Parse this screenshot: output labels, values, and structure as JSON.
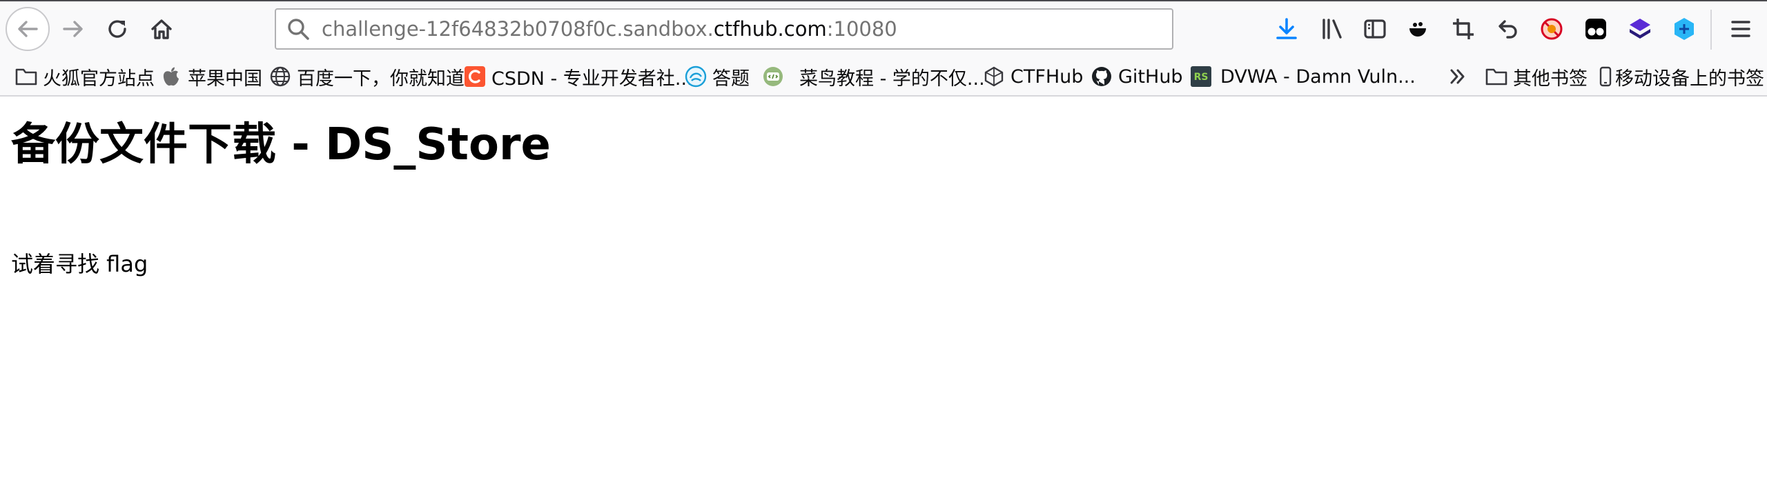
{
  "toolbar": {
    "url_prefix": "challenge-12f64832b0708f0c.sandbox.",
    "url_domain": "ctfhub.com",
    "url_suffix": ":10080"
  },
  "bookmarks": [
    {
      "label": "火狐官方站点",
      "icon": "folder-icon"
    },
    {
      "label": "苹果中国",
      "icon": "apple-icon"
    },
    {
      "label": "百度一下，你就知道",
      "icon": "globe-icon"
    },
    {
      "label": "CSDN - 专业开发者社...",
      "icon": "csdn-icon"
    },
    {
      "label": "答题",
      "icon": "quiz-icon"
    },
    {
      "label": "菜鸟教程 - 学的不仅...",
      "icon": "runoob-icon"
    },
    {
      "label": "CTFHub",
      "icon": "ctfhub-icon"
    },
    {
      "label": "GitHub",
      "icon": "github-icon"
    },
    {
      "label": "DVWA - Damn Vuln...",
      "icon": "dvwa-icon"
    }
  ],
  "bookmarks_right": {
    "other_label": "其他书签",
    "mobile_label": "移动设备上的书签"
  },
  "page": {
    "title": "备份文件下载 - DS_Store",
    "text": "试着寻找 flag"
  },
  "colors": {
    "accent": "#0a84ff",
    "csdn": "#fc5531",
    "dvwa": "#4a7c3a"
  }
}
